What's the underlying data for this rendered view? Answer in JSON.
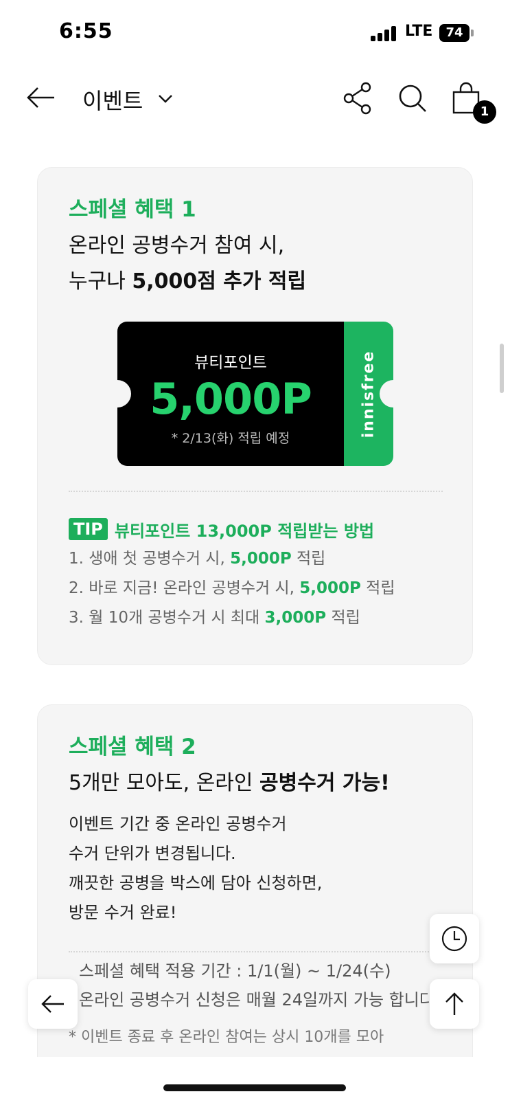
{
  "status_bar": {
    "time": "6:55",
    "network": "LTE",
    "battery": "74"
  },
  "header": {
    "title": "이벤트",
    "cart_count": "1"
  },
  "card1": {
    "label": "스페셜 혜택 1",
    "heading_line1": "온라인 공병수거 참여 시,",
    "heading_line2_normal": "누구나 ",
    "heading_line2_bold": "5,000점 추가 적립",
    "coupon": {
      "title": "뷰티포인트",
      "value": "5,000P",
      "note": "* 2/13(화) 적립 예정",
      "brand": "innisfree"
    },
    "tip_badge": "TIP",
    "tip_title": "뷰티포인트 13,000P 적립받는 방법",
    "tips": [
      {
        "pre": "1. 생애 첫 공병수거 시, ",
        "hl": "5,000P",
        "post": " 적립"
      },
      {
        "pre": "2. 바로 지금! 온라인 공병수거 시, ",
        "hl": "5,000P",
        "post": " 적립"
      },
      {
        "pre": "3. 월 10개 공병수거 시 최대 ",
        "hl": "3,000P",
        "post": " 적립"
      }
    ]
  },
  "card2": {
    "label": "스페셜 혜택 2",
    "heading_normal1": "5개만 모아도, 온라인 ",
    "heading_bold": "공병수거 가능!",
    "body_lines": [
      "이벤트 기간 중 온라인 공병수거",
      "수거 단위가 변경됩니다.",
      "깨끗한 공병을 박스에 담아 신청하면,",
      "방문 수거 완료!"
    ],
    "period_lines": [
      "스페셜 혜택 적용 기간 : 1/1(월) ~ 1/24(수)",
      "온라인 공병수거 신청은 매월 24일까지 가능 합니다."
    ],
    "event_note": "* 이벤트 종료 후 온라인 참여는 상시 10개를 모아"
  }
}
